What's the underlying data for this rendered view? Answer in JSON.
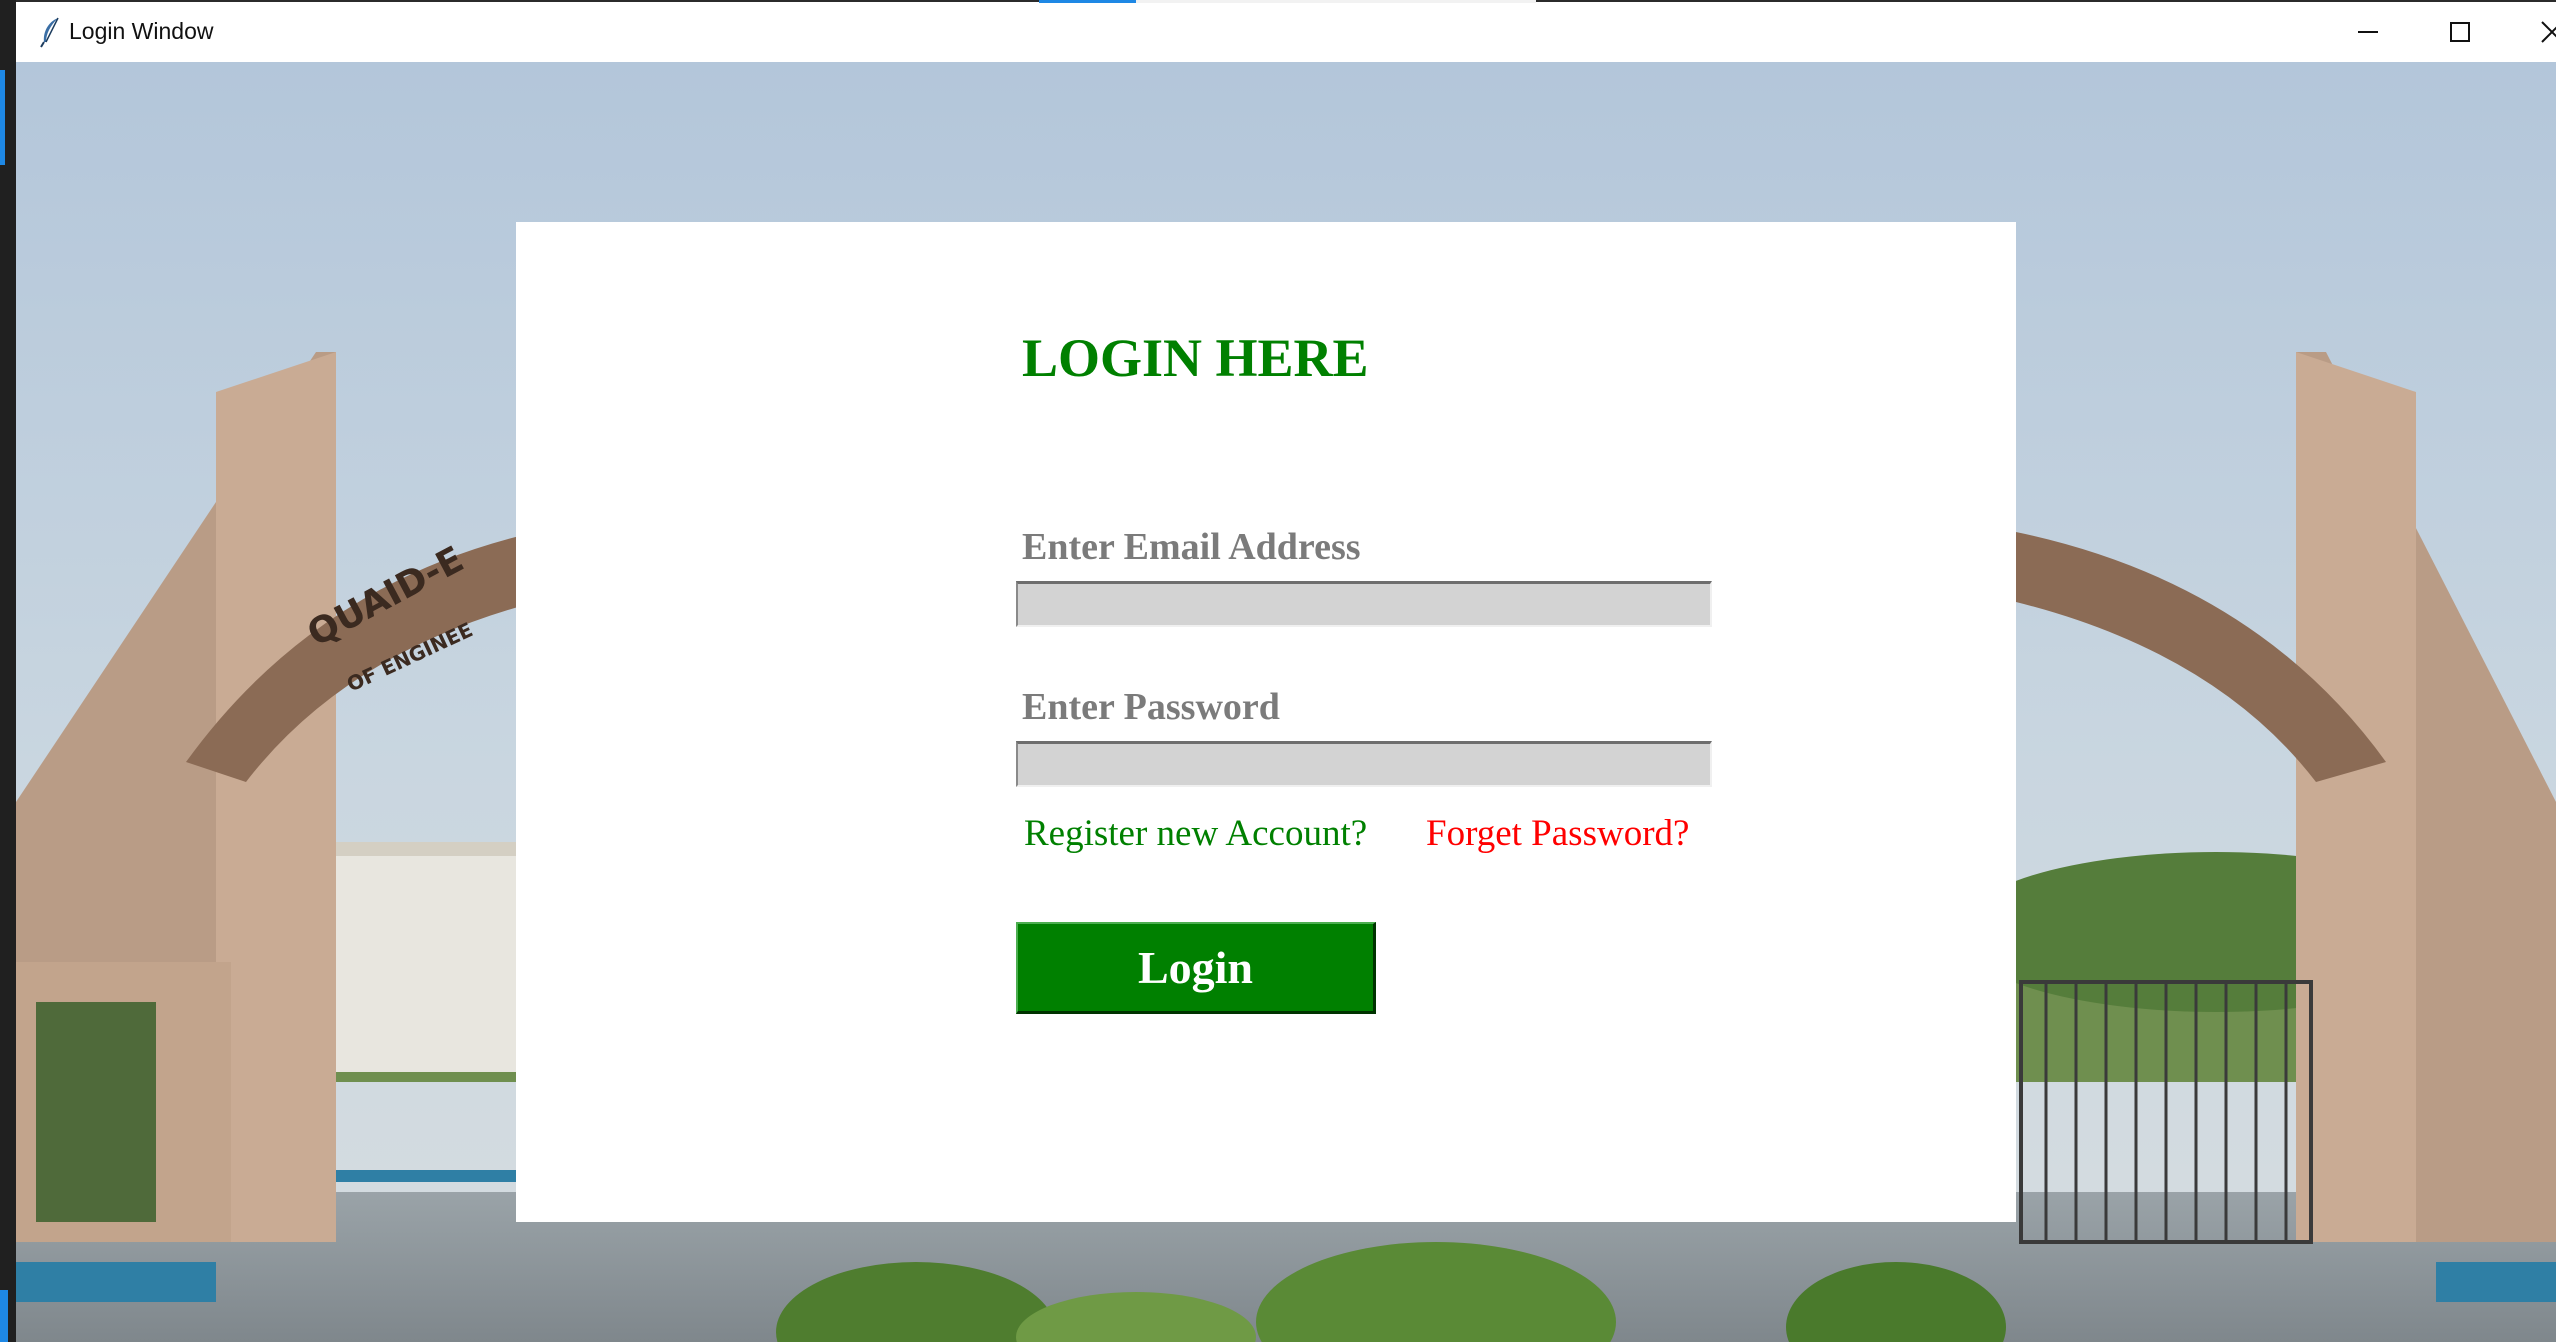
{
  "window": {
    "title": "Login Window",
    "controls": {
      "minimize": "minimize",
      "maximize": "maximize",
      "close": "close"
    }
  },
  "background": {
    "gate_text_left": "QUAID-E",
    "gate_subtext_left": "OF ENGINEE"
  },
  "form": {
    "heading": "LOGIN HERE",
    "email_label": "Enter Email Address",
    "email_value": "",
    "password_label": "Enter Password",
    "password_value": "",
    "register_link": "Register new Account?",
    "forget_link": "Forget Password?",
    "login_button": "Login"
  },
  "colors": {
    "heading": "#008000",
    "label": "#7b7b7b",
    "register_link": "#008000",
    "forget_link": "#ff0000",
    "button_bg": "#008000",
    "field_bg": "#d3d3d3"
  }
}
